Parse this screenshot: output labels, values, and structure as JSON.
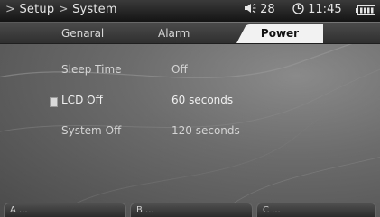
{
  "status_bar": {
    "breadcrumb": [
      ">",
      "Setup",
      ">",
      "System"
    ],
    "volume": "28",
    "time": "11:45",
    "icons": [
      "speaker-icon",
      "clock-icon",
      "battery-icon"
    ]
  },
  "tabs": [
    {
      "label": "Genaral",
      "active": false
    },
    {
      "label": "Alarm",
      "active": false
    },
    {
      "label": "Power",
      "active": true
    }
  ],
  "settings": [
    {
      "label": "Sleep Time",
      "value": "Off",
      "selected": false
    },
    {
      "label": "LCD Off",
      "value": "60 seconds",
      "selected": true
    },
    {
      "label": "System Off",
      "value": "120 seconds",
      "selected": false
    }
  ],
  "softkeys": [
    {
      "label": "A ..."
    },
    {
      "label": "B ..."
    },
    {
      "label": "C ..."
    }
  ],
  "colors": {
    "background": "#6c6c6c",
    "active_tab": "#f2f2f2",
    "text": "#d4d4d4"
  }
}
